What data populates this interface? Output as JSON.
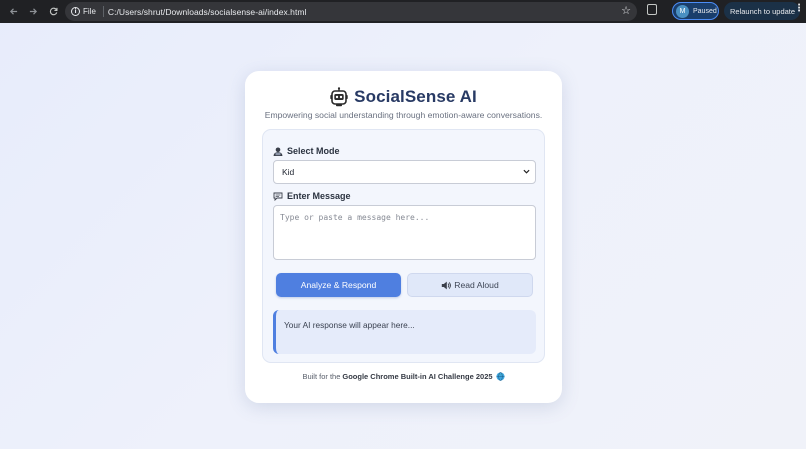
{
  "browser": {
    "url_scheme_label": "File",
    "url": "C:/Users/shrut/Downloads/socialsense-ai/index.html",
    "profile_initial": "M",
    "profile_status": "Paused",
    "relaunch_label": "Relaunch to update"
  },
  "app": {
    "title": "SocialSense AI",
    "subtitle": "Empowering social understanding through emotion-aware conversations.",
    "mode": {
      "label": "Select Mode",
      "selected": "Kid"
    },
    "message": {
      "label": "Enter Message",
      "placeholder": "Type or paste a message here..."
    },
    "buttons": {
      "analyze": "Analyze & Respond",
      "read_aloud": "Read Aloud"
    },
    "response_placeholder": "Your AI response will appear here...",
    "footer": {
      "prefix": "Built for the",
      "highlight": "Google Chrome Built-in AI Challenge 2025"
    }
  },
  "colors": {
    "accent": "#4f7fe0",
    "title": "#283a64",
    "chrome_bg": "#202124"
  },
  "icons": [
    "back-arrow-icon",
    "forward-arrow-icon",
    "reload-icon",
    "info-icon",
    "star-icon",
    "extensions-icon",
    "kebab-menu-icon",
    "robot-icon",
    "person-icon",
    "speech-bubble-icon",
    "speaker-icon",
    "globe-icon",
    "chevron-down-icon"
  ]
}
